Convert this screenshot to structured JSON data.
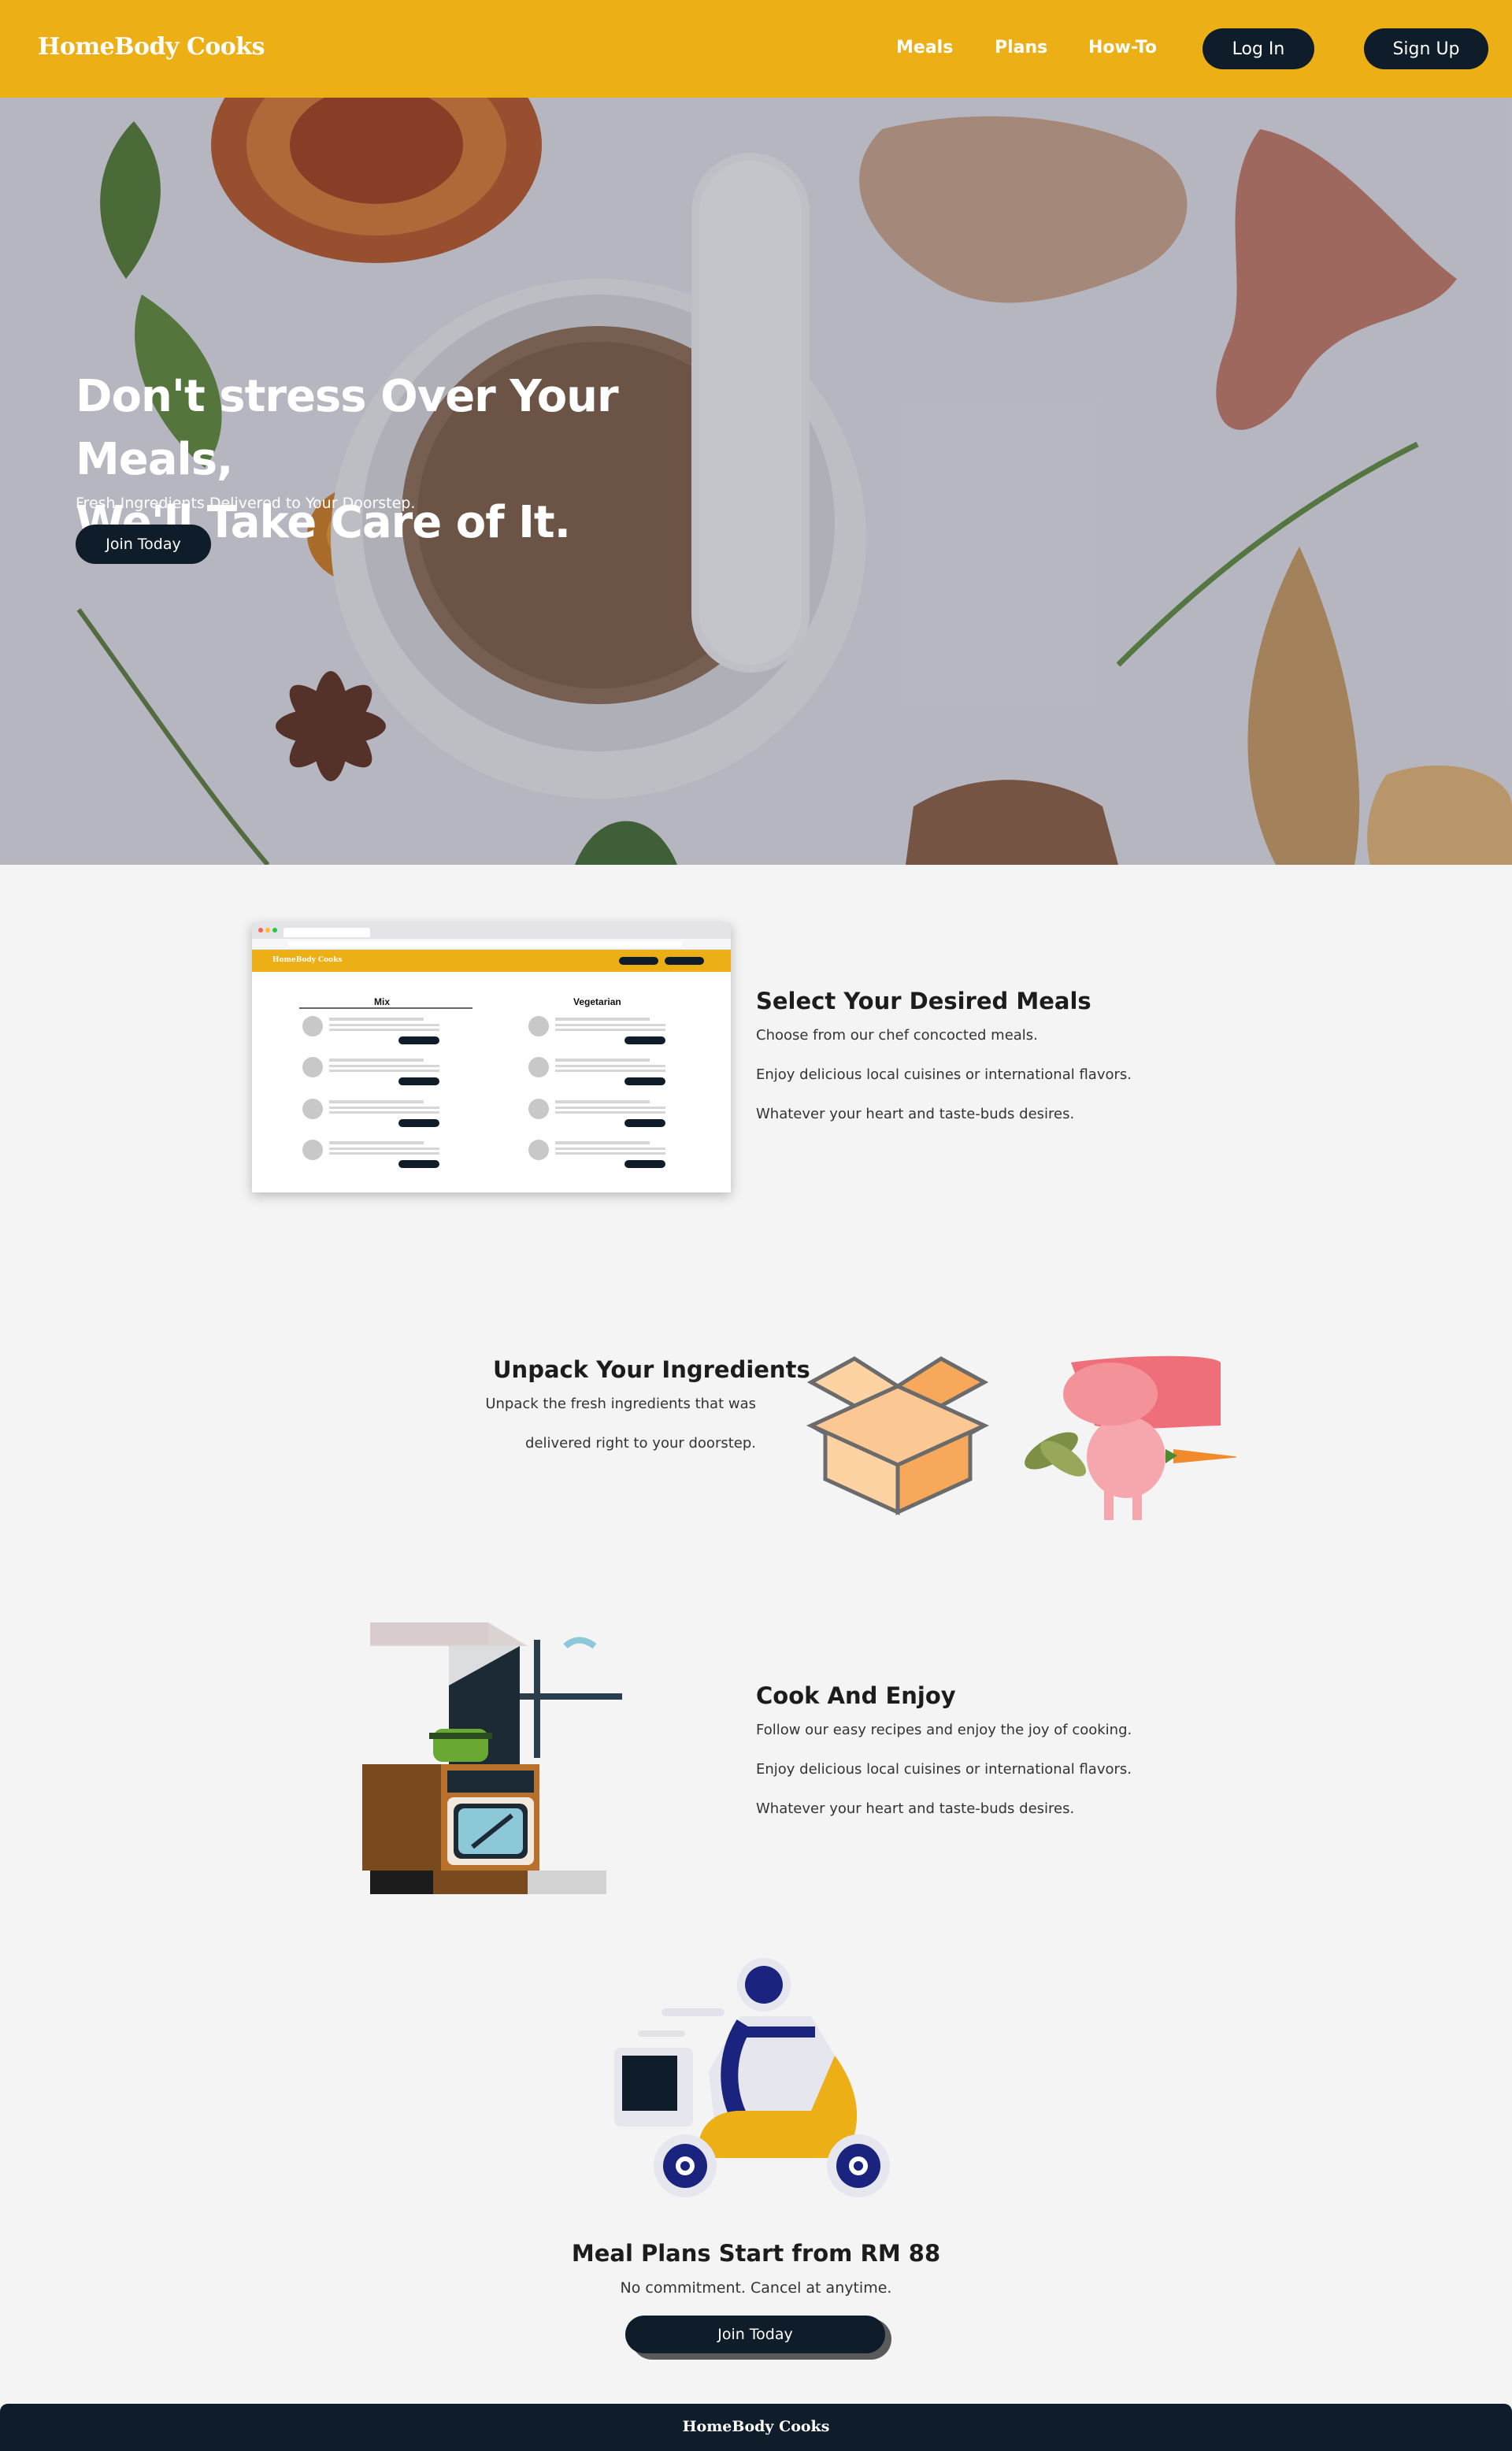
{
  "navbar": {
    "brand": "HomeBody Cooks",
    "links": [
      "Meals",
      "Plans",
      "How-To"
    ],
    "login_label": "Log In",
    "signup_label": "Sign Up"
  },
  "hero": {
    "title_line1": "Don't stress Over Your Meals,",
    "title_line2": "We'll Take Care of It.",
    "subtitle": "Fresh Ingredients Delivered to Your Doorstep.",
    "cta_label": "Join Today"
  },
  "steps": [
    {
      "title": "Select Your Desired Meals",
      "lines": [
        "Choose from our chef concocted meals.",
        "Enjoy delicious local cuisines or international flavors.",
        "Whatever your heart and taste-buds desires."
      ]
    },
    {
      "title": "Unpack Your Ingredients",
      "lines": [
        "Unpack the fresh ingredients that was",
        "delivered right to your doorstep."
      ]
    },
    {
      "title": "Cook And Enjoy",
      "lines": [
        "Follow our easy recipes and enjoy the joy of cooking.",
        "Enjoy delicious local cuisines or international flavors.",
        "Whatever your heart and taste-buds desires."
      ]
    }
  ],
  "mockup": {
    "brand": "HomeBody Cooks",
    "columns": [
      "Mix",
      "Vegetarian"
    ]
  },
  "cta": {
    "title": "Meal Plans Start from RM 88",
    "subtitle": "No commitment. Cancel at anytime.",
    "button_label": "Join Today"
  },
  "footer": {
    "brand": "HomeBody Cooks"
  },
  "colors": {
    "accent": "#ecb016",
    "dark": "#0f1d2a",
    "background": "#f4f4f4"
  },
  "icons": [
    "mortar-pestle-photo",
    "browser-mockup",
    "box-icon",
    "ingredients-illustration",
    "kitchen-stove-illustration",
    "delivery-scooter-illustration"
  ]
}
